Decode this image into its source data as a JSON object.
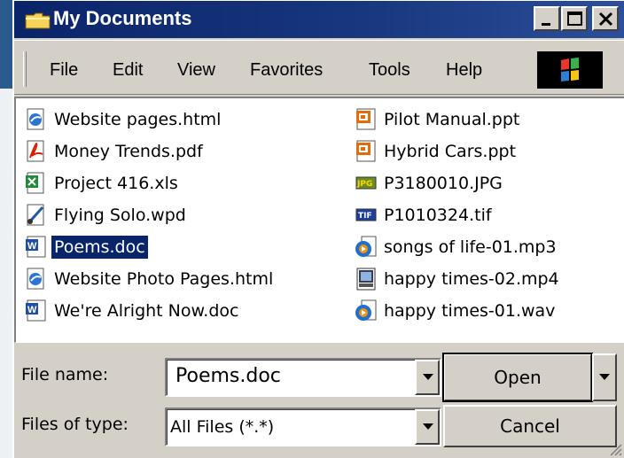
{
  "window": {
    "title": "My Documents"
  },
  "menu": [
    "File",
    "Edit",
    "View",
    "Favorites",
    "Tools",
    "Help"
  ],
  "files_left": [
    {
      "name": "Website pages.html",
      "icon": "html-file-icon"
    },
    {
      "name": "Money Trends.pdf",
      "icon": "pdf-file-icon"
    },
    {
      "name": "Project 416.xls",
      "icon": "excel-file-icon"
    },
    {
      "name": "Flying Solo.wpd",
      "icon": "wordperfect-file-icon"
    },
    {
      "name": "Poems.doc",
      "icon": "word-file-icon",
      "selected": true
    },
    {
      "name": "Website Photo Pages.html",
      "icon": "html-file-icon"
    },
    {
      "name": "We're Alright Now.doc",
      "icon": "word-file-icon"
    }
  ],
  "files_right": [
    {
      "name": "Pilot Manual.ppt",
      "icon": "powerpoint-file-icon"
    },
    {
      "name": "Hybrid Cars.ppt",
      "icon": "powerpoint-file-icon"
    },
    {
      "name": "P3180010.JPG",
      "icon": "jpg-file-icon"
    },
    {
      "name": "P1010324.tif",
      "icon": "tif-file-icon"
    },
    {
      "name": "songs of life-01.mp3",
      "icon": "media-file-icon"
    },
    {
      "name": "happy times-02.mp4",
      "icon": "video-file-icon"
    },
    {
      "name": "happy times-01.wav",
      "icon": "media-file-icon"
    }
  ],
  "filename": {
    "label": "File name:",
    "value": "Poems.doc"
  },
  "filetype": {
    "label": "Files of type:",
    "value": "All Files (*.*)"
  },
  "buttons": {
    "open": "Open",
    "cancel": "Cancel"
  },
  "colors": {
    "titlebar": "#0a246a",
    "selection": "#0a246a",
    "face": "#d4d0c8"
  }
}
